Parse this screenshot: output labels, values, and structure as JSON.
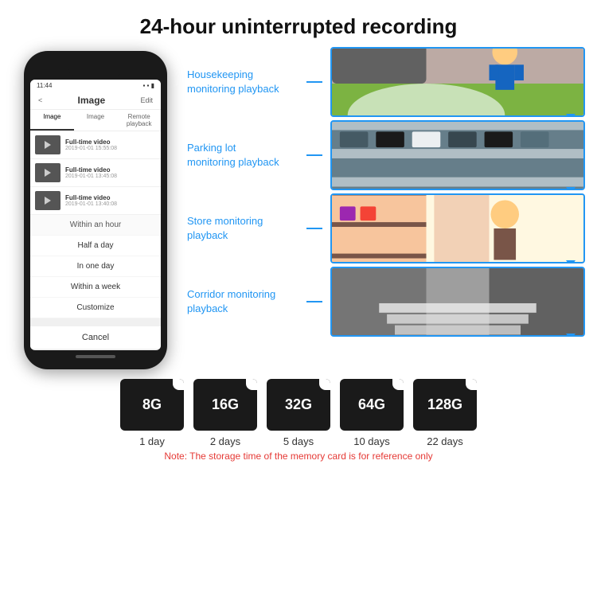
{
  "header": {
    "title": "24-hour uninterrupted recording"
  },
  "phone": {
    "time": "11:44",
    "screen_title": "Image",
    "back_label": "<",
    "edit_label": "Edit",
    "tab_image": "Image",
    "tab_remote": "Remote playback",
    "tab_image_short": "Image",
    "video_items": [
      {
        "title": "Full-time video",
        "date": "2019-01-01 15:55:08"
      },
      {
        "title": "Full-time video",
        "date": "2019-01-01 13:45:08"
      },
      {
        "title": "Full-time video",
        "date": "2019-01-01 13:40:08"
      }
    ],
    "dropdown_items": [
      {
        "label": "Within an hour",
        "highlighted": true
      },
      {
        "label": "Half a day",
        "highlighted": false
      },
      {
        "label": "In one day",
        "highlighted": false
      },
      {
        "label": "Within a week",
        "highlighted": false
      },
      {
        "label": "Customize",
        "highlighted": false
      }
    ],
    "cancel_label": "Cancel"
  },
  "monitoring": {
    "items": [
      {
        "label": "Housekeeping monitoring playback",
        "img_type": "housekeeping"
      },
      {
        "label": "Parking lot monitoring playback",
        "img_type": "parking"
      },
      {
        "label": "Store monitoring playback",
        "img_type": "store"
      },
      {
        "label": "Corridor monitoring playback",
        "img_type": "corridor"
      }
    ]
  },
  "storage": {
    "cards": [
      {
        "size": "8G",
        "days": "1 day"
      },
      {
        "size": "16G",
        "days": "2 days"
      },
      {
        "size": "32G",
        "days": "5 days"
      },
      {
        "size": "64G",
        "days": "10 days"
      },
      {
        "size": "128G",
        "days": "22 days"
      }
    ],
    "note": "Note: The storage time of the memory card is for reference only"
  },
  "colors": {
    "accent_blue": "#2196F3",
    "card_bg": "#1a1a1a",
    "note_red": "#e53935"
  }
}
